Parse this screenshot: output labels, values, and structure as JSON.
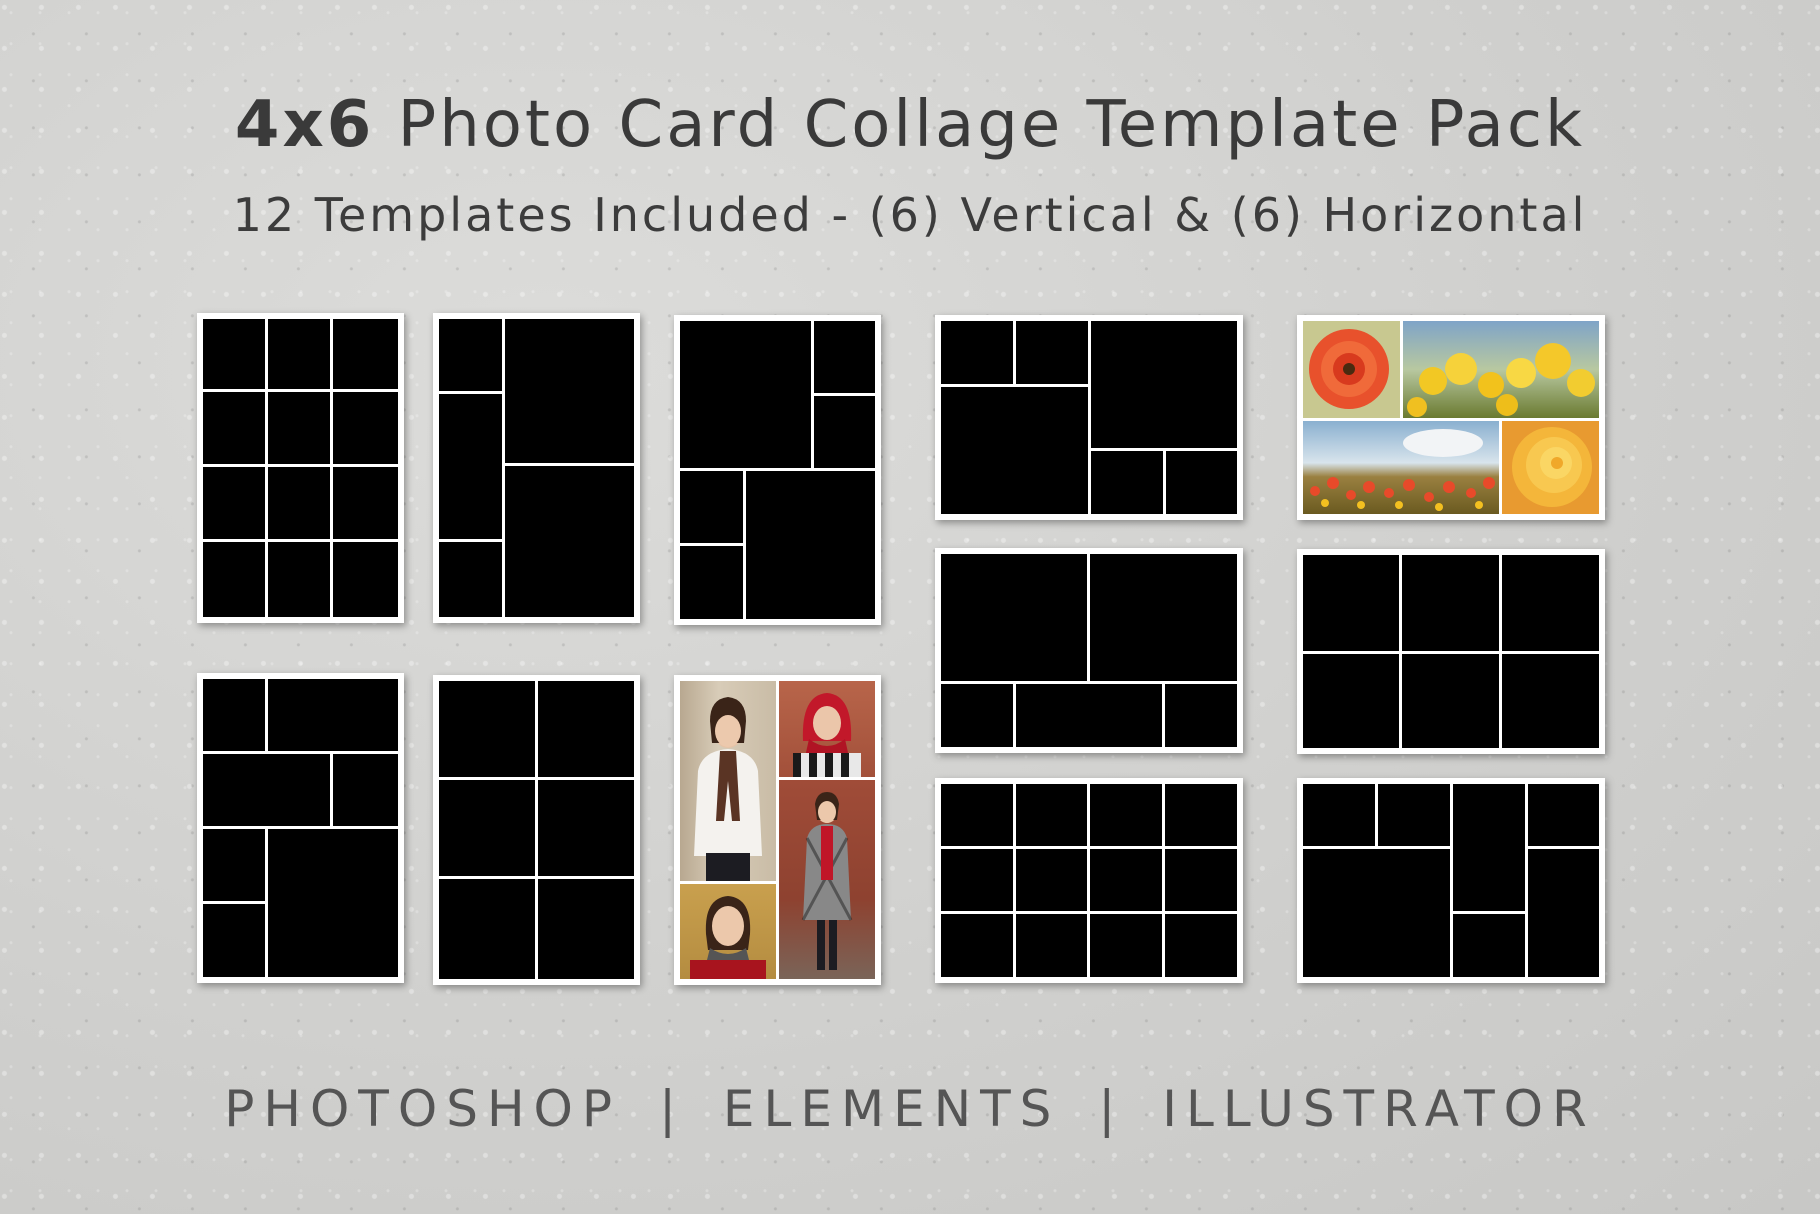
{
  "title": {
    "bold": "4x6",
    "rest": "Photo Card Collage Template Pack"
  },
  "subtitle": "12 Templates Included - (6) Vertical & (6) Horizontal",
  "footer": {
    "app1": "PHOTOSHOP",
    "sep": "|",
    "app2": "ELEMENTS",
    "app3": "ILLUSTRATOR"
  },
  "templates": [
    {
      "id": "v1",
      "orientation": "vertical",
      "layout": "4x3 grid"
    },
    {
      "id": "v2",
      "orientation": "vertical",
      "layout": "narrow column + two large"
    },
    {
      "id": "v3",
      "orientation": "vertical",
      "layout": "large + side strips"
    },
    {
      "id": "v4",
      "orientation": "vertical",
      "layout": "mixed blocks"
    },
    {
      "id": "v5",
      "orientation": "vertical",
      "layout": "3x2 grid"
    },
    {
      "id": "v6",
      "orientation": "vertical",
      "layout": "photo sample - woman in red scarf"
    },
    {
      "id": "h1",
      "orientation": "horizontal",
      "layout": "mixed blocks"
    },
    {
      "id": "h2",
      "orientation": "horizontal",
      "layout": "photo sample - flowers"
    },
    {
      "id": "h3",
      "orientation": "horizontal",
      "layout": "two large + bottom strip"
    },
    {
      "id": "h4",
      "orientation": "horizontal",
      "layout": "2x3 grid"
    },
    {
      "id": "h5",
      "orientation": "horizontal",
      "layout": "3x4 grid"
    },
    {
      "id": "h6",
      "orientation": "horizontal",
      "layout": "mixed blocks"
    }
  ],
  "colors": {
    "background": "#d4d4d2",
    "card_border": "#ffffff",
    "placeholder": "#000000"
  }
}
